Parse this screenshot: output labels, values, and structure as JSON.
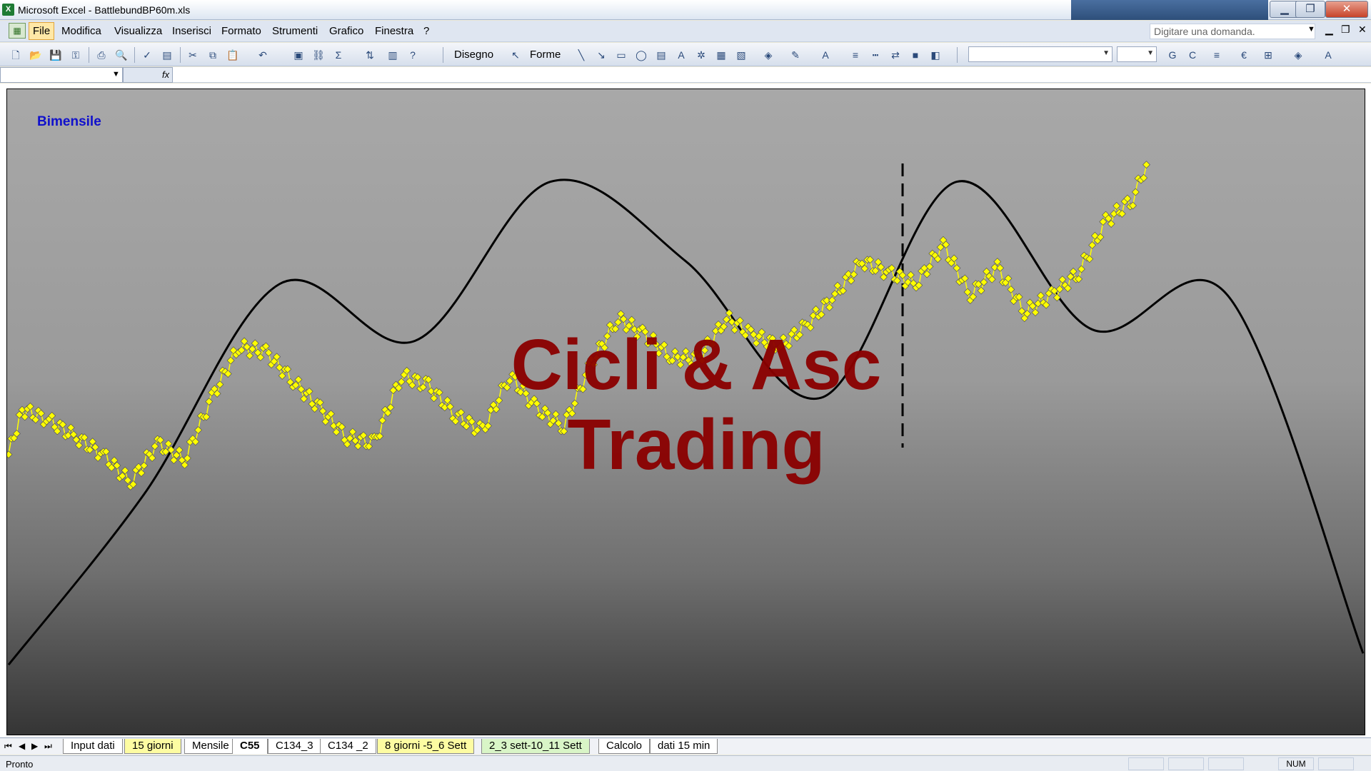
{
  "window": {
    "title": "Microsoft Excel - BattlebundBP60m.xls"
  },
  "menubar": {
    "items": [
      "File",
      "Modifica",
      "Visualizza",
      "Inserisci",
      "Formato",
      "Strumenti",
      "Grafico",
      "Finestra",
      "?"
    ],
    "question_placeholder": "Digitare una domanda."
  },
  "toolbar": {
    "disegno_label": "Disegno",
    "forme_label": "Forme",
    "fx_label": "fx"
  },
  "chart": {
    "label_bimensile": "Bimensile",
    "watermark_line1": "Cicli & Asc",
    "watermark_line2": "Trading"
  },
  "chart_data": {
    "type": "line",
    "title": "",
    "series": [
      {
        "name": "",
        "role": "cycle",
        "color": "#000000",
        "x": [
          0,
          10,
          20,
          30,
          40,
          50,
          60,
          70,
          80,
          90,
          100
        ],
        "y": [
          0.05,
          0.35,
          0.72,
          0.62,
          0.9,
          0.76,
          0.52,
          0.9,
          0.64,
          0.7,
          0.07
        ]
      },
      {
        "name": "",
        "role": "price",
        "color": "#ffff00",
        "x": [
          0,
          1,
          3,
          5,
          7,
          9,
          11,
          13,
          15,
          17,
          19,
          21,
          23,
          25,
          27,
          29,
          31,
          33,
          35,
          37,
          39,
          41,
          43,
          45,
          47,
          49,
          51,
          53,
          55,
          57,
          59,
          61,
          63,
          65,
          67,
          69,
          71,
          73,
          75,
          77,
          79,
          81,
          83,
          84
        ],
        "y": [
          0.42,
          0.5,
          0.48,
          0.45,
          0.42,
          0.37,
          0.44,
          0.41,
          0.52,
          0.61,
          0.6,
          0.55,
          0.5,
          0.45,
          0.44,
          0.56,
          0.54,
          0.49,
          0.46,
          0.56,
          0.5,
          0.47,
          0.58,
          0.66,
          0.63,
          0.59,
          0.59,
          0.66,
          0.63,
          0.61,
          0.65,
          0.7,
          0.76,
          0.74,
          0.72,
          0.79,
          0.7,
          0.75,
          0.67,
          0.7,
          0.74,
          0.83,
          0.87,
          0.93
        ]
      }
    ],
    "annotations": [
      "dashed vertical line"
    ],
    "grid": false
  },
  "sheet_tabs": [
    "Input dati",
    "15 giorni",
    "Mensile",
    "C55",
    "C134_3",
    "C134 _2",
    "8 giorni -5_6 Sett",
    "2_3 sett-10_11 Sett",
    "Calcolo",
    "dati 15 min"
  ],
  "statusbar": {
    "status": "Pronto",
    "num": "NUM"
  }
}
